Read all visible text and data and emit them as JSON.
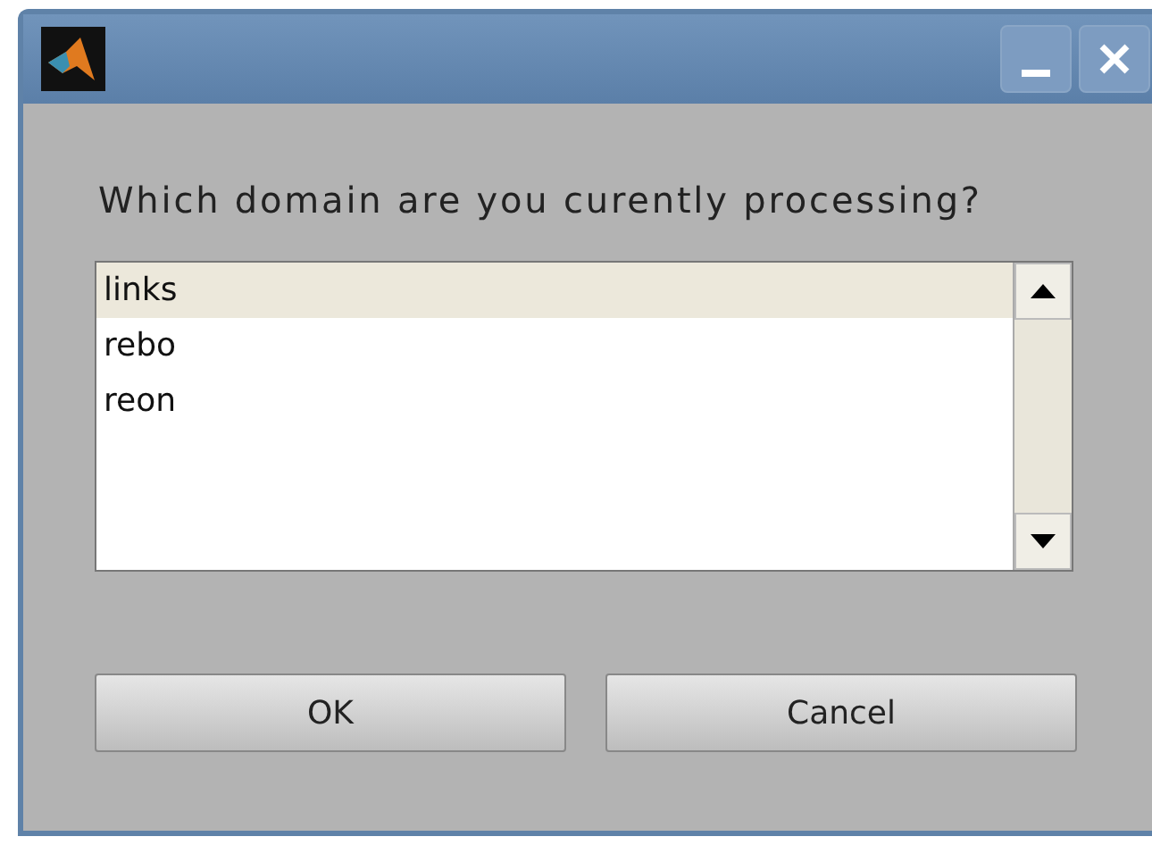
{
  "window": {
    "title_buttons": [
      {
        "kind": "minimize"
      },
      {
        "kind": "close"
      }
    ]
  },
  "prompt": "Which domain are you curently processing?",
  "list": {
    "items": [
      {
        "label": "links",
        "selected": true
      },
      {
        "label": "rebo",
        "selected": false
      },
      {
        "label": "reon",
        "selected": false
      }
    ]
  },
  "buttons": [
    "OK",
    "Cancel"
  ]
}
